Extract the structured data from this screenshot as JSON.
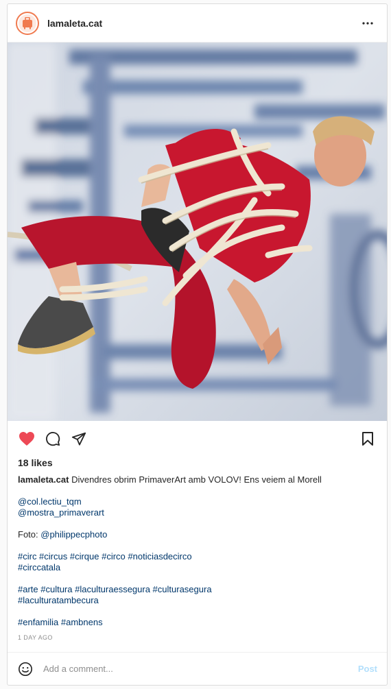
{
  "post": {
    "username": "lamaleta.cat",
    "likes_text": "18 likes",
    "caption_author": "lamaleta.cat",
    "caption_text": "Divendres obrim PrimaverArt amb VOLOV! Ens veiem al Morell",
    "mention_1": "@col.lectiu_tqm",
    "mention_2": "@mostra_primaverart",
    "foto_label": "Foto:",
    "foto_mention": "@philippecphoto",
    "tags_line_1": "#circ #circus #cirque #circo #noticiasdecirco",
    "tags_line_2": "#circcatala",
    "tags_line_3": "#arte #cultura #laculturaessegura #culturasegura",
    "tags_line_4": "#laculturatambecura",
    "tags_line_5": "#enfamilia #ambnens",
    "time_ago": "1 day ago"
  },
  "comment": {
    "placeholder": "Add a comment...",
    "post_label": "Post"
  },
  "icons": {
    "more": "more-dots-icon",
    "like": "heart-filled-icon",
    "comment": "comment-bubble-icon",
    "share": "paper-plane-icon",
    "save": "bookmark-icon",
    "emoji": "smiley-icon",
    "avatar": "suitcase-logo-icon"
  },
  "colors": {
    "like_red": "#ed4956",
    "link_blue": "#00376b",
    "post_button": "#b2dffc",
    "avatar_ring": "#f07a4f"
  }
}
